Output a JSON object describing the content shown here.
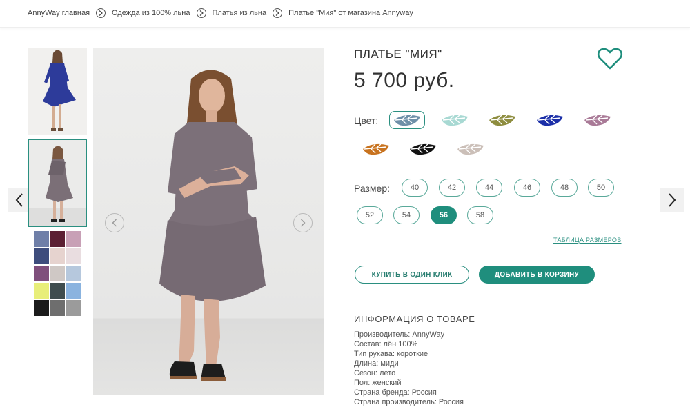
{
  "breadcrumb": [
    "AnnyWay главная",
    "Одежда из 100% льна",
    "Платья из льна",
    "Платье \"Мия\" от магазина Annyway"
  ],
  "product": {
    "title": "ПЛАТЬЕ \"МИЯ\"",
    "price": "5 700 руб."
  },
  "color": {
    "label": "Цвет:",
    "swatches": [
      {
        "name": "blue-grey",
        "hex": "#6e8fa8",
        "selected": true
      },
      {
        "name": "mint",
        "hex": "#a8d9d3",
        "selected": false
      },
      {
        "name": "olive",
        "hex": "#8e8d3f",
        "selected": false
      },
      {
        "name": "royal-blue",
        "hex": "#1b2fa8",
        "selected": false
      },
      {
        "name": "mauve",
        "hex": "#a97a97",
        "selected": false
      },
      {
        "name": "orange",
        "hex": "#c8731f",
        "selected": false
      },
      {
        "name": "black",
        "hex": "#121212",
        "selected": false
      },
      {
        "name": "beige-grey",
        "hex": "#cbbfb8",
        "selected": false
      }
    ]
  },
  "size": {
    "label": "Размер:",
    "options": [
      "40",
      "42",
      "44",
      "46",
      "48",
      "50",
      "52",
      "54",
      "56",
      "58"
    ],
    "selected": "56",
    "table_link": "ТАБЛИЦА РАЗМЕРОВ"
  },
  "buttons": {
    "one_click": "КУПИТЬ В ОДИН КЛИК",
    "add_to_cart": "ДОБАВИТЬ В КОРЗИНУ"
  },
  "info": {
    "title": "ИНФОРМАЦИЯ О ТОВАРЕ",
    "lines": [
      "Производитель: AnnyWay",
      "Состав: лён 100%",
      "Тип рукава: короткие",
      "Длина: миди",
      "Сезон: лето",
      "Пол: женский",
      "Страна бренда: Россия",
      "Страна производитель: Россия"
    ]
  },
  "colors": {
    "accent": "#1f8e7d",
    "dress": "#7a6e76",
    "fabric_swatches": [
      "#6f7fa8",
      "#5b1f33",
      "#c8a0b6",
      "#3e4d7d",
      "#e6d3cf",
      "#e9dde0",
      "#7f4f7c",
      "#cfc8c5",
      "#b6c8dd",
      "#e8ee7a",
      "#3f4d4f",
      "#8ab3df",
      "#1b1b1b",
      "#6e6e6e",
      "#9b9b9b"
    ]
  },
  "icons": {
    "fav": "heart-outline-icon",
    "prev": "chevron-left-icon",
    "next": "chevron-right-icon",
    "crumb_sep": "circle-chevron-right-icon"
  }
}
